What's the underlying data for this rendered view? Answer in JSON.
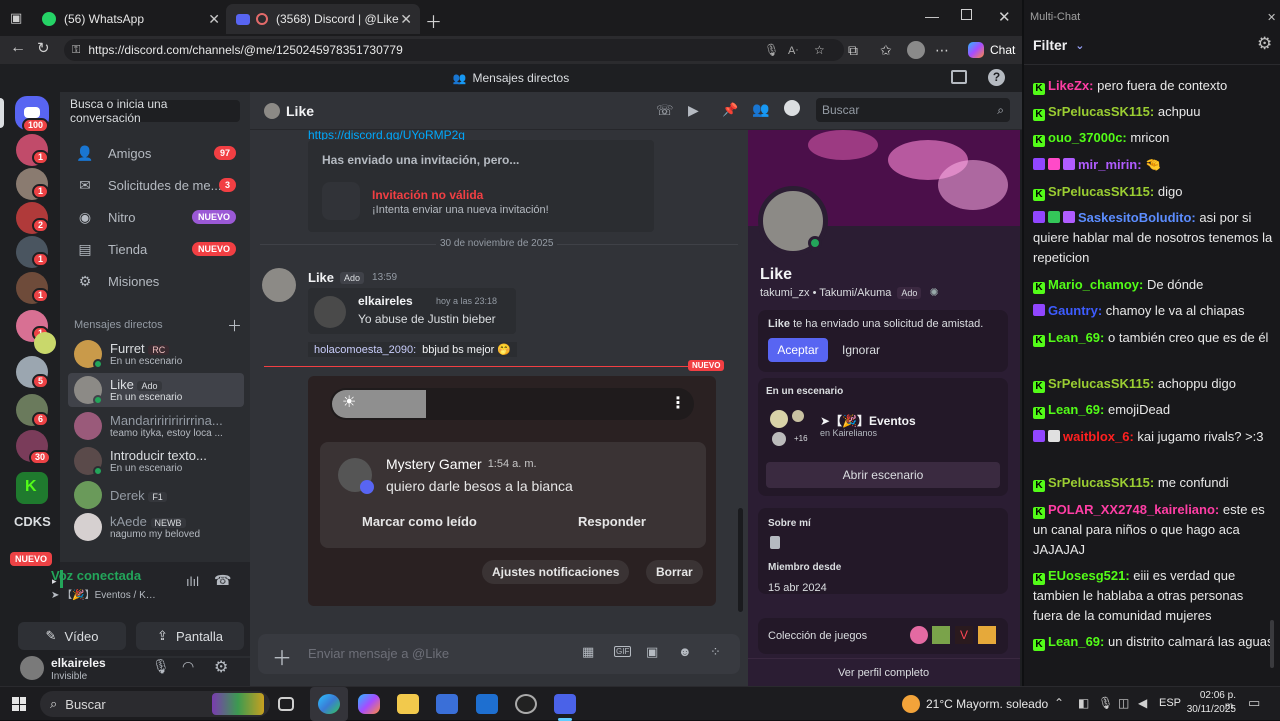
{
  "browser": {
    "tabs": [
      {
        "label": "(56) WhatsApp",
        "active": false
      },
      {
        "label": "(3568) Discord | @Like",
        "active": true
      }
    ],
    "url": "https://discord.com/channels/@me/1250245978351730779",
    "chat_button": "Chat"
  },
  "discord": {
    "title": "Mensajes directos",
    "guild_badges": [
      "100",
      "1",
      "1",
      "2",
      "1",
      "1",
      "1",
      "1",
      "5",
      "6",
      "30"
    ],
    "cdks": "CDKS",
    "nuevo_badge": "NUEVO",
    "dm_column": {
      "search": "Busca o inicia una conversación",
      "nav": [
        {
          "label": "Amigos",
          "badge": "97",
          "badge_color": "#f23f43"
        },
        {
          "label": "Solicitudes de me...",
          "badge": "3",
          "badge_color": "#f23f43"
        },
        {
          "label": "Nitro",
          "badge": "NUEVO",
          "badge_color": "#9b59d6"
        },
        {
          "label": "Tienda",
          "badge": "NUEVO",
          "badge_color": "#f23f43"
        },
        {
          "label": "Misiones",
          "badge": "",
          "badge_color": ""
        }
      ],
      "dm_header": "Mensajes directos",
      "dms": [
        {
          "name": "Furret",
          "tag": "RC",
          "status": "En un escenario"
        },
        {
          "name": "Like",
          "tag": "Ado",
          "status": "En un escenario"
        },
        {
          "name": "Mandariririririrrina...",
          "tag": "",
          "status": "teamo ityka, estoy loca ..."
        },
        {
          "name": "Introducir texto...",
          "tag": "",
          "status": "En un escenario"
        },
        {
          "name": "Derek",
          "tag": "F1",
          "status": ""
        },
        {
          "name": "kAede",
          "tag": "NEWB",
          "status": "nagumo my beloved"
        }
      ],
      "voice": {
        "title": "Voz conectada",
        "channel": "➤ 【🎉】Eventos / Kaireli...",
        "video": "Vídeo",
        "screen": "Pantalla"
      },
      "user": {
        "name": "elkaireles",
        "status": "Invisible"
      }
    },
    "chat": {
      "name": "Like",
      "search": "Buscar",
      "invite_link": "https://discord.gg/UYoRMP2g",
      "invite_title": "Has enviado una invitación, pero...",
      "invite_invalid": "Invitación no válida",
      "invite_sub": "¡Intenta enviar una nueva invitación!",
      "date_divider": "30 de noviembre de 2025",
      "message": {
        "author": "Like",
        "tag": "Ado",
        "time": "13:59"
      },
      "quote": {
        "author": "elkaireles",
        "time": "hoy a las 23:18",
        "text": "Yo abuse de Justin bieber"
      },
      "reply": {
        "mention": "holacomoesta_2090:",
        "text": "bbjud bs mejor 🤭"
      },
      "new_label": "NUEVO",
      "notification": {
        "title": "Mystery Gamer",
        "time": "1:54 a. m.",
        "text": "quiero darle besos a la bianca",
        "mark_read": "Marcar como leído",
        "reply": "Responder",
        "settings": "Ajustes notificaciones",
        "delete": "Borrar"
      },
      "composer_placeholder": "Enviar mensaje a @Like"
    },
    "profile": {
      "name": "Like",
      "handle": "takumi_zx • Takumi/Akuma",
      "tag": "Ado",
      "request_text": "te ha enviado una solicitud de amistad.",
      "request_name": "Like",
      "accept": "Aceptar",
      "ignore": "Ignorar",
      "stage_header": "En un escenario",
      "stage_title": "➤【🎉】Eventos",
      "stage_server": "en Kairelianos",
      "stage_count": "+16",
      "open_stage": "Abrir escenario",
      "about": "Sobre mí",
      "member_since": "Miembro desde",
      "member_date": "15 abr 2024",
      "games": "Colección de juegos",
      "full_profile": "Ver perfil completo"
    }
  },
  "multichat": {
    "title": "Multi-Chat",
    "filter": "Filter",
    "messages": [
      {
        "platform": "kick",
        "user": "LikeZx:",
        "color": "#ff3ea5",
        "text": "pero fuera de contexto"
      },
      {
        "platform": "kick",
        "user": "SrPelucasSK115:",
        "color": "#9acd32",
        "text": "achpuu"
      },
      {
        "platform": "kick",
        "user": "ouo_37000c:",
        "color": "#53fc18",
        "text": "mricon"
      },
      {
        "platform": "twitch",
        "user": "mir_mirin:",
        "color": "#b05cff",
        "text": "🤏"
      },
      {
        "platform": "kick",
        "user": "SrPelucasSK115:",
        "color": "#9acd32",
        "text": "digo"
      },
      {
        "platform": "twitch",
        "user": "SaskesitoBoludito:",
        "color": "#5c8dff",
        "text": "asi por si quiere hablar mal de nosotros tenemos la repeticion"
      },
      {
        "platform": "kick",
        "user": "Mario_chamoy:",
        "color": "#53fc18",
        "text": "De dónde"
      },
      {
        "platform": "twitch",
        "user": "Gauntry:",
        "color": "#3d5cff",
        "text": "chamoy le va al chiapas"
      },
      {
        "platform": "kick",
        "user": "Lean_69:",
        "color": "#53fc18",
        "text": "o también creo que es de él"
      },
      {
        "platform": "kick",
        "user": "SrPelucasSK115:",
        "color": "#9acd32",
        "text": "achoppu digo"
      },
      {
        "platform": "kick",
        "user": "Lean_69:",
        "color": "#53fc18",
        "text": "emojiDead"
      },
      {
        "platform": "twitch",
        "user": "waitblox_6:",
        "color": "#ff2020",
        "text": "kai jugamo rivals? >:3"
      },
      {
        "platform": "kick",
        "user": "SrPelucasSK115:",
        "color": "#9acd32",
        "text": "me confundi"
      },
      {
        "platform": "kick",
        "user": "POLAR_XX2748_kaireliano:",
        "color": "#ff3ea5",
        "text": "este es un canal para niños o que hago aca JAJAJAJ"
      },
      {
        "platform": "kick",
        "user": "EUosesg521:",
        "color": "#53fc18",
        "text": "eiii es verdad que tambien le hablaba a otras personas fuera de la comunidad mujeres"
      },
      {
        "platform": "kick",
        "user": "Lean_69:",
        "color": "#53fc18",
        "text": "un distrito calmará las aguas"
      }
    ]
  },
  "taskbar": {
    "search": "Buscar",
    "weather_temp": "21°C",
    "weather_text": "Mayorm. soleado",
    "lang": "ESP",
    "time": "02:06 p. m.",
    "date": "30/11/2025"
  }
}
